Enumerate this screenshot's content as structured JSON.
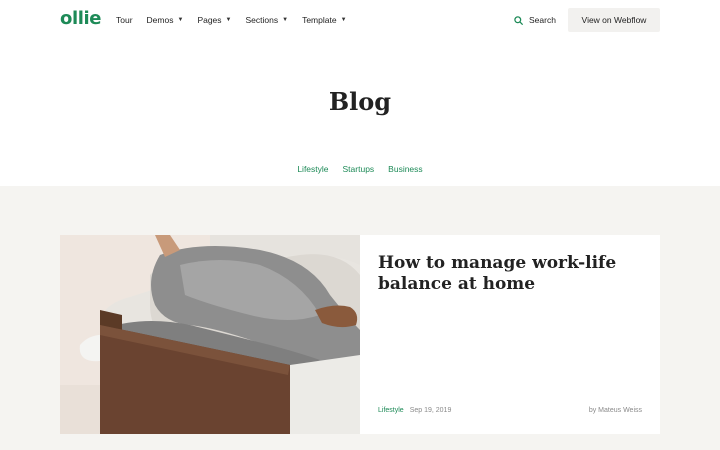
{
  "header": {
    "logo": "ollie",
    "nav": [
      {
        "label": "Tour",
        "has_dropdown": false
      },
      {
        "label": "Demos",
        "has_dropdown": true
      },
      {
        "label": "Pages",
        "has_dropdown": true
      },
      {
        "label": "Sections",
        "has_dropdown": true
      },
      {
        "label": "Template",
        "has_dropdown": true
      }
    ],
    "search_label": "Search",
    "search_icon": "search-icon",
    "cta_label": "View on Webflow"
  },
  "hero": {
    "title": "Blog",
    "categories": [
      "Lifestyle",
      "Startups",
      "Business"
    ]
  },
  "featured_post": {
    "image_alt_icon": "lounging-person-on-sofa-photo",
    "title": "How to manage work-life balance at home",
    "category": "Lifestyle",
    "date": "Sep 19, 2019",
    "author": "by Mateus Weiss"
  },
  "colors": {
    "brand_green": "#1d8a57",
    "section_bg": "#f5f4f1",
    "button_bg": "#f2f1ef"
  }
}
